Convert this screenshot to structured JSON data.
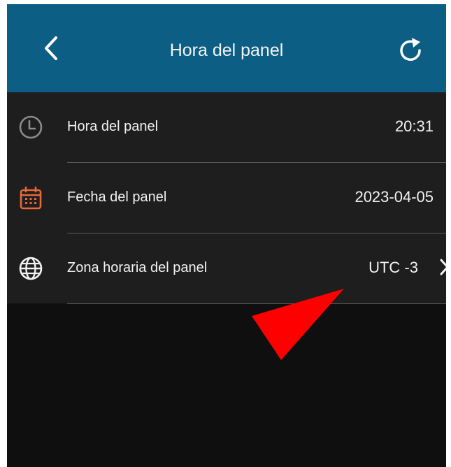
{
  "header": {
    "title": "Hora del panel",
    "back_icon": "chevron-left-icon",
    "refresh_icon": "refresh-icon",
    "background": "#0d5e85"
  },
  "rows": [
    {
      "label": "Hora del panel",
      "value": "20:31",
      "icon": "clock-icon"
    },
    {
      "label": "Fecha del panel",
      "value": "2023-04-05",
      "icon": "calendar-icon",
      "icon_color": "#e8683a"
    },
    {
      "label": "Zona horaria del panel",
      "value": "UTC -3",
      "icon": "globe-icon"
    }
  ],
  "annotation": {
    "icon": "red-arrow-pointer",
    "color": "#ff0000"
  }
}
